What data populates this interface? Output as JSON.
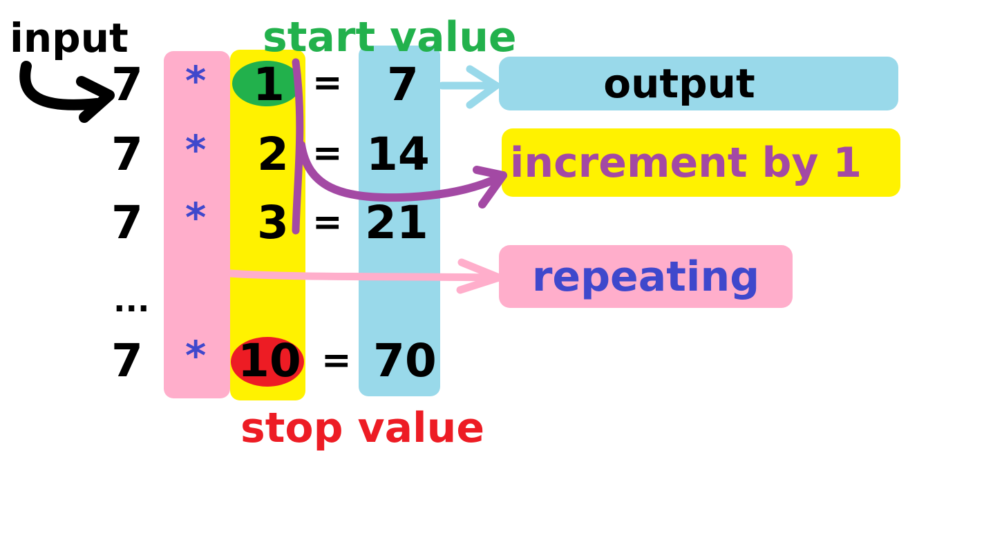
{
  "labels": {
    "input": "input",
    "start_value": "start value",
    "stop_value": "stop value",
    "output": "output",
    "increment": "increment by 1",
    "repeating": "repeating"
  },
  "rows": [
    {
      "input": "7",
      "operator": "*",
      "counter": "1",
      "equals": "=",
      "result": "7"
    },
    {
      "input": "7",
      "operator": "*",
      "counter": "2",
      "equals": "=",
      "result": "14"
    },
    {
      "input": "7",
      "operator": "*",
      "counter": "3",
      "equals": "=",
      "result": "21"
    },
    {
      "input": "7",
      "operator": "*",
      "counter": "10",
      "equals": "=",
      "result": "70"
    }
  ],
  "ellipsis": "...",
  "colors": {
    "pink": "#ffaecb",
    "yellow": "#fff200",
    "blue": "#99d9ea",
    "green": "#22b14c",
    "red": "#ed1c24",
    "purple": "#a349a4",
    "indigo": "#3f48cc",
    "black": "#000000"
  }
}
